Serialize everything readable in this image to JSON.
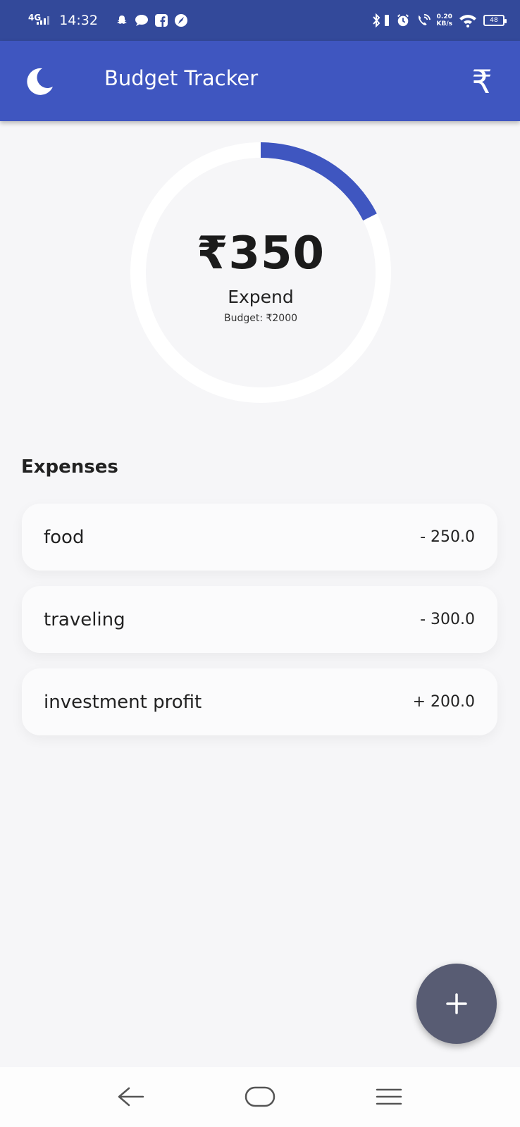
{
  "status_bar": {
    "network": "4G",
    "time": "14:32",
    "speed_value": "0.20",
    "speed_unit": "KB/s",
    "battery": "48",
    "icons": [
      "snapchat-icon",
      "chat-bubble-icon",
      "facebook-icon",
      "compass-app-icon",
      "bluetooth-icon",
      "vibrate-icon",
      "alarm-icon",
      "wifi-calling-icon",
      "wifi-icon",
      "battery-icon"
    ]
  },
  "app_bar": {
    "title": "Budget Tracker",
    "left_icon": "moon-icon",
    "right_icon_glyph": "₹",
    "color": "#3f56c0"
  },
  "summary": {
    "amount": "₹350",
    "label": "Expend",
    "budget_text": "Budget: ₹2000",
    "progress_fraction": 0.175,
    "progress_color": "#3f56c0"
  },
  "expenses": {
    "title": "Expenses",
    "items": [
      {
        "name": "food",
        "amount": "- 250.0"
      },
      {
        "name": "traveling",
        "amount": "- 300.0"
      },
      {
        "name": "investment profit",
        "amount": "+ 200.0"
      }
    ]
  },
  "fab": {
    "icon": "plus-icon",
    "color": "#585c73"
  },
  "nav_bar": {
    "icons": [
      "back-arrow-icon",
      "home-icon",
      "menu-icon"
    ]
  }
}
